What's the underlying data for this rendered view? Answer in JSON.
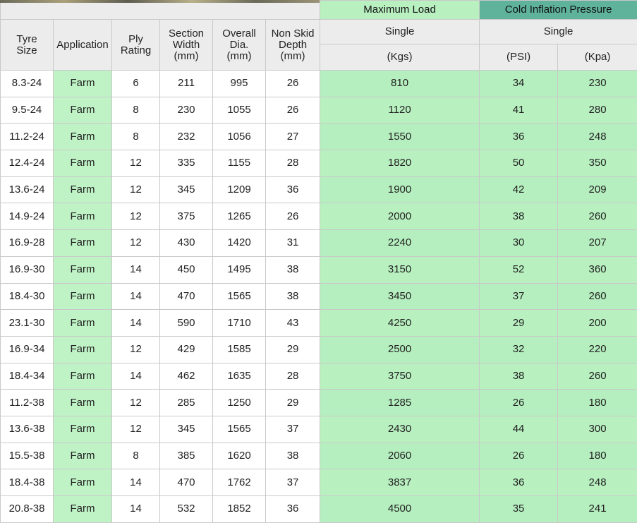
{
  "headers": {
    "tyre_size": "Tyre Size",
    "application": "Application",
    "ply_rating": "Ply Rating",
    "section_width": "Section Width (mm)",
    "overall_dia": "Overall Dia. (mm)",
    "non_skid_depth": "Non Skid Depth (mm)",
    "maximum_load": "Maximum Load",
    "max_load_single": "Single",
    "max_load_unit": "(Kgs)",
    "cold_inflation_pressure": "Cold Inflation Pressure",
    "pressure_single": "Single",
    "psi_unit": "(PSI)",
    "kpa_unit": "(Kpa)"
  },
  "rows": [
    {
      "size": "8.3-24",
      "app": "Farm",
      "ply": "6",
      "width": "211",
      "dia": "995",
      "depth": "26",
      "load": "810",
      "psi": "34",
      "kpa": "230"
    },
    {
      "size": "9.5-24",
      "app": "Farm",
      "ply": "8",
      "width": "230",
      "dia": "1055",
      "depth": "26",
      "load": "1120",
      "psi": "41",
      "kpa": "280"
    },
    {
      "size": "11.2-24",
      "app": "Farm",
      "ply": "8",
      "width": "232",
      "dia": "1056",
      "depth": "27",
      "load": "1550",
      "psi": "36",
      "kpa": "248"
    },
    {
      "size": "12.4-24",
      "app": "Farm",
      "ply": "12",
      "width": "335",
      "dia": "1155",
      "depth": "28",
      "load": "1820",
      "psi": "50",
      "kpa": "350"
    },
    {
      "size": "13.6-24",
      "app": "Farm",
      "ply": "12",
      "width": "345",
      "dia": "1209",
      "depth": "36",
      "load": "1900",
      "psi": "42",
      "kpa": "209"
    },
    {
      "size": "14.9-24",
      "app": "Farm",
      "ply": "12",
      "width": "375",
      "dia": "1265",
      "depth": "26",
      "load": "2000",
      "psi": "38",
      "kpa": "260"
    },
    {
      "size": "16.9-28",
      "app": "Farm",
      "ply": "12",
      "width": "430",
      "dia": "1420",
      "depth": "31",
      "load": "2240",
      "psi": "30",
      "kpa": "207"
    },
    {
      "size": "16.9-30",
      "app": "Farm",
      "ply": "14",
      "width": "450",
      "dia": "1495",
      "depth": "38",
      "load": "3150",
      "psi": "52",
      "kpa": "360"
    },
    {
      "size": "18.4-30",
      "app": "Farm",
      "ply": "14",
      "width": "470",
      "dia": "1565",
      "depth": "38",
      "load": "3450",
      "psi": "37",
      "kpa": "260"
    },
    {
      "size": "23.1-30",
      "app": "Farm",
      "ply": "14",
      "width": "590",
      "dia": "1710",
      "depth": "43",
      "load": "4250",
      "psi": "29",
      "kpa": "200"
    },
    {
      "size": "16.9-34",
      "app": "Farm",
      "ply": "12",
      "width": "429",
      "dia": "1585",
      "depth": "29",
      "load": "2500",
      "psi": "32",
      "kpa": "220"
    },
    {
      "size": "18.4-34",
      "app": "Farm",
      "ply": "14",
      "width": "462",
      "dia": "1635",
      "depth": "28",
      "load": "3750",
      "psi": "38",
      "kpa": "260"
    },
    {
      "size": "11.2-38",
      "app": "Farm",
      "ply": "12",
      "width": "285",
      "dia": "1250",
      "depth": "29",
      "load": "1285",
      "psi": "26",
      "kpa": "180"
    },
    {
      "size": "13.6-38",
      "app": "Farm",
      "ply": "12",
      "width": "345",
      "dia": "1565",
      "depth": "37",
      "load": "2430",
      "psi": "44",
      "kpa": "300"
    },
    {
      "size": "15.5-38",
      "app": "Farm",
      "ply": "8",
      "width": "385",
      "dia": "1620",
      "depth": "38",
      "load": "2060",
      "psi": "26",
      "kpa": "180"
    },
    {
      "size": "18.4-38",
      "app": "Farm",
      "ply": "14",
      "width": "470",
      "dia": "1762",
      "depth": "37",
      "load": "3837",
      "psi": "36",
      "kpa": "248"
    },
    {
      "size": "20.8-38",
      "app": "Farm",
      "ply": "14",
      "width": "532",
      "dia": "1852",
      "depth": "36",
      "load": "4500",
      "psi": "35",
      "kpa": "241"
    }
  ],
  "colors": {
    "green_light": "#b8f0c0",
    "teal_header": "#5fb39a",
    "header_gray": "#ececec"
  }
}
